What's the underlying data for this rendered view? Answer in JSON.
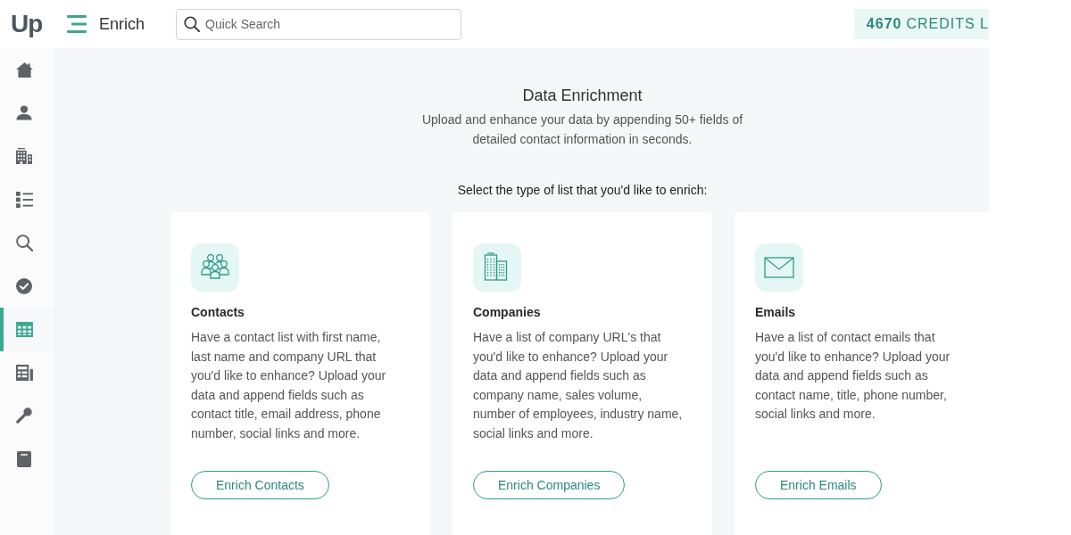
{
  "header": {
    "logo": "Up",
    "page_title": "Enrich",
    "search": {
      "placeholder": "Quick Search"
    },
    "credits": {
      "count": "4670",
      "label": "CREDITS L"
    }
  },
  "sidebar": {
    "items": [
      {
        "kind": "home",
        "selected": false
      },
      {
        "kind": "person",
        "selected": false
      },
      {
        "kind": "building",
        "selected": false
      },
      {
        "kind": "list",
        "selected": false
      },
      {
        "kind": "search",
        "selected": false
      },
      {
        "kind": "check",
        "selected": false
      },
      {
        "kind": "table",
        "selected": true
      },
      {
        "kind": "ledger",
        "selected": false
      },
      {
        "kind": "microphone",
        "selected": false
      },
      {
        "kind": "book",
        "selected": false
      }
    ]
  },
  "intro": {
    "title": "Data Enrichment",
    "description": "Upload and enhance your data by appending 50+ fields of detailed contact information in seconds.",
    "prompt": "Select the type of list that you'd like to enrich:"
  },
  "cards": [
    {
      "kind": "contacts",
      "title": "Contacts",
      "description": "Have a contact list with first name, last name and company URL that you'd like to enhance? Upload your data and append fields such as contact title, email address, phone number, social links and more.",
      "button": "Enrich Contacts"
    },
    {
      "kind": "companies",
      "title": "Companies",
      "description": "Have a list of company URL's that you'd like to enhance? Upload your data and append fields such as company name, sales volume, number of employees, industry name, social links and more.",
      "button": "Enrich Companies"
    },
    {
      "kind": "emails",
      "title": "Emails",
      "description": "Have a list of contact emails that you'd like to enhance? Upload your data and append fields such as contact name, title, phone number, social links and more.",
      "button": "Enrich Emails"
    }
  ]
}
